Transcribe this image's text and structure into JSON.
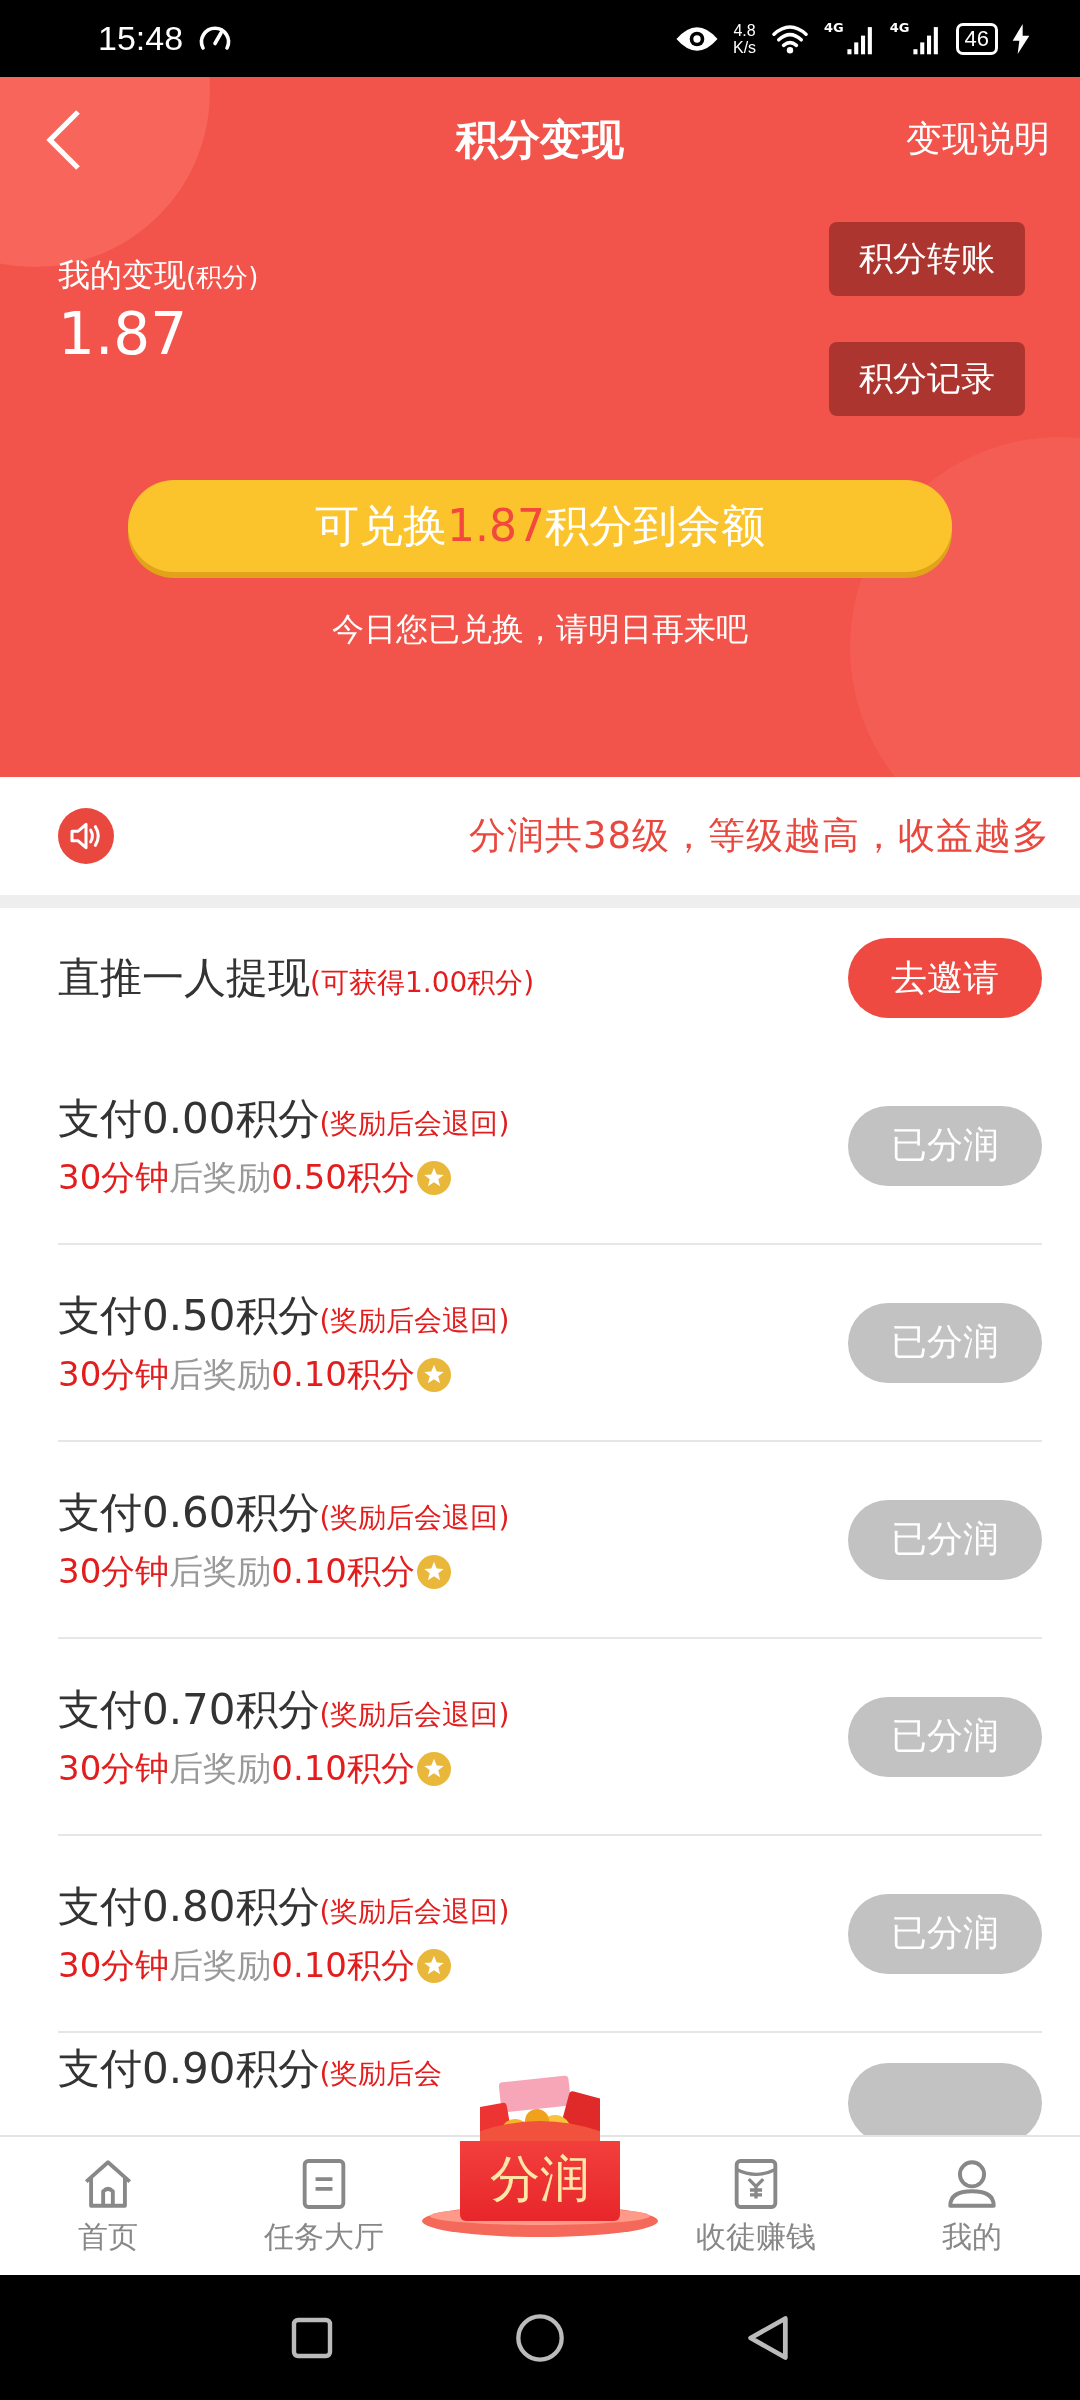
{
  "status_bar": {
    "time": "15:48",
    "net_speed": "4.8",
    "net_unit": "K/s",
    "battery": "46",
    "signals": [
      "4G",
      "4G"
    ]
  },
  "header": {
    "title": "积分变现",
    "action": "变现说明"
  },
  "balance": {
    "label": "我的变现",
    "unit": "(积分)",
    "value": "1.87"
  },
  "side_buttons": [
    "积分转账",
    "积分记录"
  ],
  "exchange": {
    "prefix": "可兑换",
    "amount": "1.87",
    "suffix": "积分到余额"
  },
  "exchange_note": "今日您已兑换，请明日再来吧",
  "notice": "分润共38级，等级越高，收益越多",
  "invite": {
    "title": "直推一人提现",
    "note": "(可获得1.00积分)",
    "button": "去邀请"
  },
  "tasks": [
    {
      "title": "支付0.00积分",
      "note": "(奖励后会退回)",
      "time": "30分钟",
      "middle": "后奖励",
      "reward": "0.50积分",
      "button": "已分润",
      "done": true
    },
    {
      "title": "支付0.50积分",
      "note": "(奖励后会退回)",
      "time": "30分钟",
      "middle": "后奖励",
      "reward": "0.10积分",
      "button": "已分润",
      "done": true
    },
    {
      "title": "支付0.60积分",
      "note": "(奖励后会退回)",
      "time": "30分钟",
      "middle": "后奖励",
      "reward": "0.10积分",
      "button": "已分润",
      "done": true
    },
    {
      "title": "支付0.70积分",
      "note": "(奖励后会退回)",
      "time": "30分钟",
      "middle": "后奖励",
      "reward": "0.10积分",
      "button": "已分润",
      "done": true
    },
    {
      "title": "支付0.80积分",
      "note": "(奖励后会退回)",
      "time": "30分钟",
      "middle": "后奖励",
      "reward": "0.10积分",
      "button": "已分润",
      "done": true
    },
    {
      "title": "支付0.90积分",
      "note": "(奖励后会",
      "done": true
    }
  ],
  "nav": [
    {
      "label": "首页",
      "kind": "home"
    },
    {
      "label": "任务大厅",
      "kind": "list"
    },
    {
      "label": "分润",
      "kind": "center"
    },
    {
      "label": "收徒赚钱",
      "kind": "envelope"
    },
    {
      "label": "我的",
      "kind": "user"
    }
  ]
}
